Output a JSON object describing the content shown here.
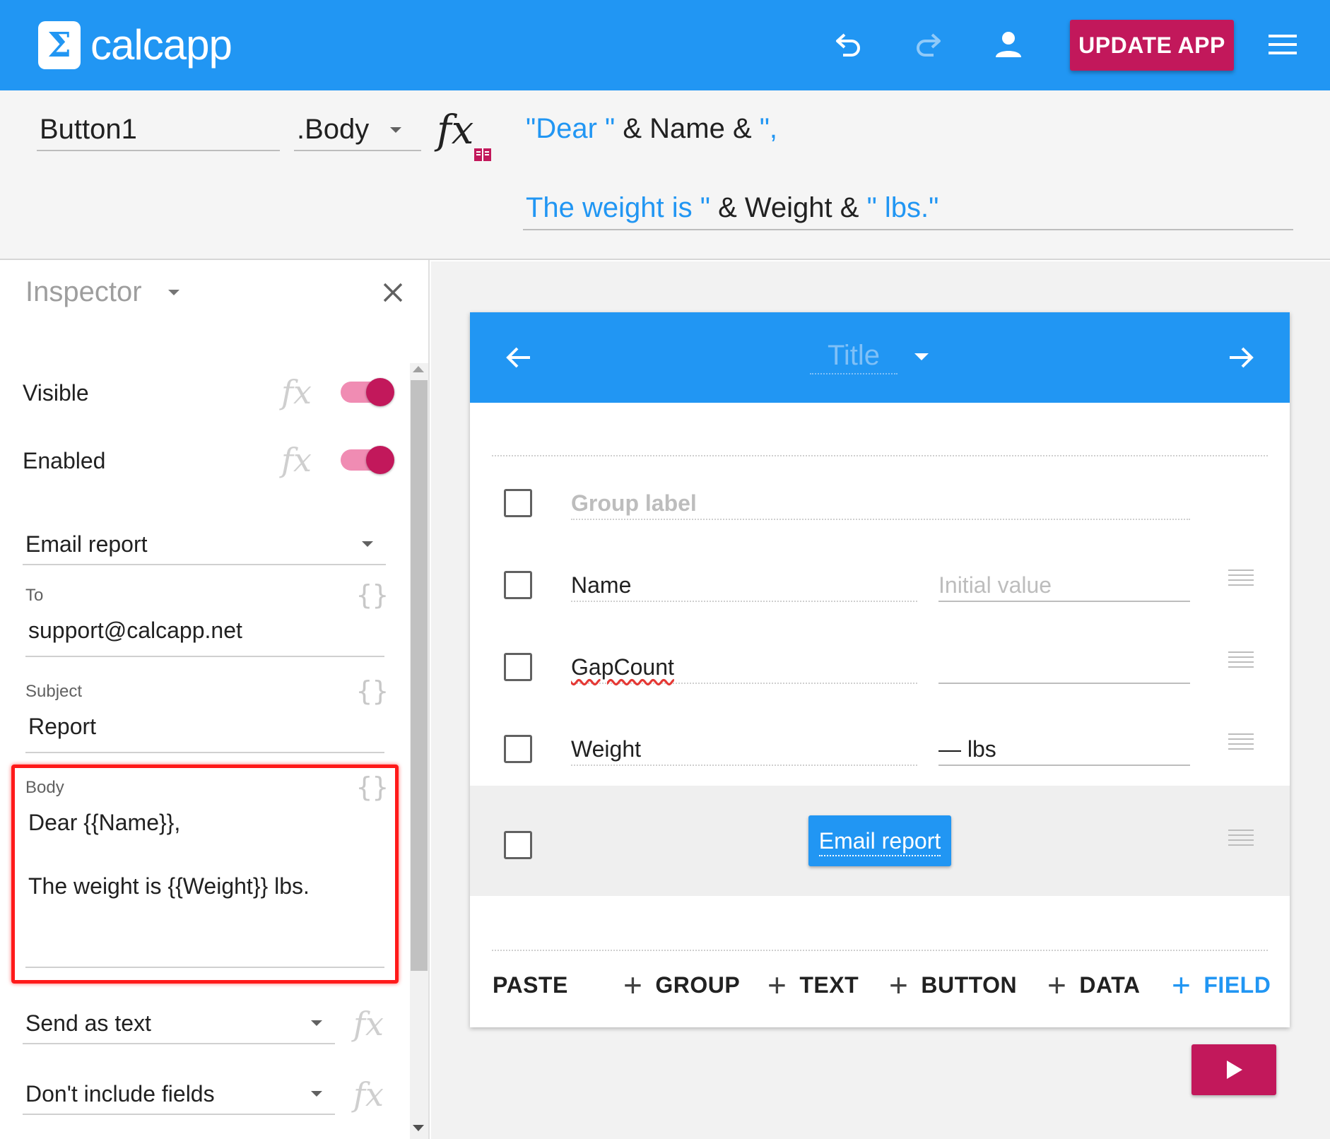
{
  "app": {
    "logo_symbol": "Σ",
    "logo_text": "calcapp",
    "update_label": "UPDATE APP",
    "icons": [
      "undo-icon",
      "redo-icon",
      "account-icon",
      "menu-icon"
    ],
    "colors": {
      "primary": "#2196f3",
      "accent": "#c2185b"
    }
  },
  "formula_bar": {
    "object_name": "Button1",
    "property": ".Body",
    "fx_label": "fx",
    "line1": [
      {
        "text": "\"Dear \"",
        "kind": "string"
      },
      {
        "text": " & Name & ",
        "kind": "plain"
      },
      {
        "text": "\",",
        "kind": "string"
      }
    ],
    "line2": [
      {
        "text": "The weight is \"",
        "kind": "string"
      },
      {
        "text": " & Weight & ",
        "kind": "plain"
      },
      {
        "text": "\" lbs.\"",
        "kind": "string"
      }
    ]
  },
  "inspector": {
    "title": "Inspector",
    "visible_label": "Visible",
    "enabled_label": "Enabled",
    "fx": "fx",
    "action": "Email report",
    "to_label": "To",
    "to_value": "support@calcapp.net",
    "subject_label": "Subject",
    "subject_value": "Report",
    "body_label": "Body",
    "body_line1": "Dear {{Name}},",
    "body_line2": "The weight is {{Weight}} lbs.",
    "braces": "{}",
    "send_as": "Send as text",
    "include_fields": "Don't include fields"
  },
  "card": {
    "title": "Title",
    "group_label": "Group label",
    "rows": [
      {
        "label": "Name",
        "value": "Initial value",
        "placeholder": true
      },
      {
        "label": "GapCount",
        "value": "",
        "placeholder": false
      },
      {
        "label": "Weight",
        "value": "— lbs",
        "placeholder": false
      }
    ],
    "button_label": "Email report",
    "actions": {
      "paste": "PASTE",
      "group": "GROUP",
      "text": "TEXT",
      "button": "BUTTON",
      "data": "DATA",
      "field": "FIELD"
    }
  }
}
